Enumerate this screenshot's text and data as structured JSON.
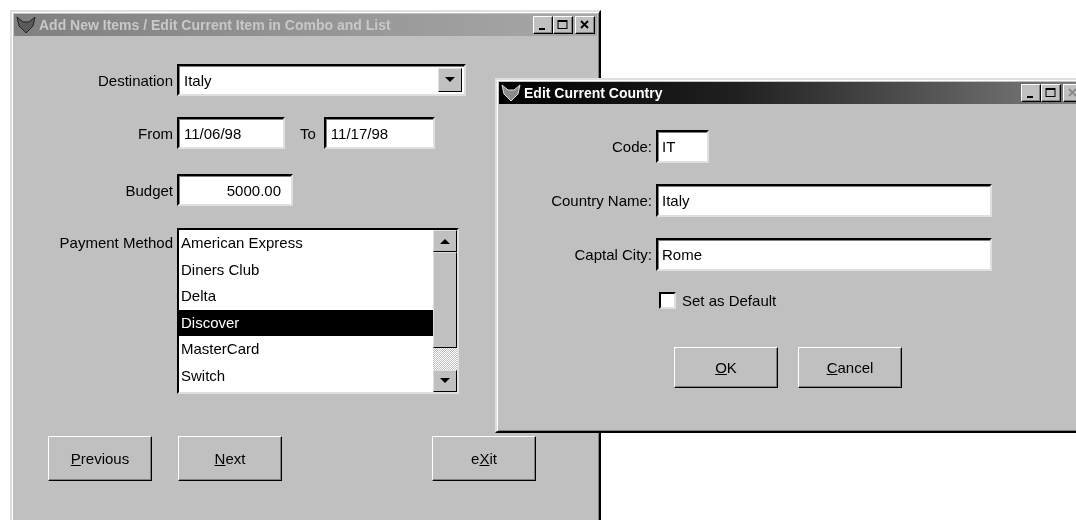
{
  "main_window": {
    "title": "Add New Items / Edit Current Item in Combo and List",
    "active": false,
    "destination": {
      "label": "Destination",
      "value": "Italy"
    },
    "from": {
      "label": "From",
      "value": "11/06/98"
    },
    "to": {
      "label": "To",
      "value": "11/17/98"
    },
    "budget": {
      "label": "Budget",
      "value": "5000.00"
    },
    "payment_method": {
      "label": "Payment Method",
      "items": [
        {
          "text": "American Express",
          "selected": false
        },
        {
          "text": "Diners Club",
          "selected": false
        },
        {
          "text": "Delta",
          "selected": false
        },
        {
          "text": "Discover",
          "selected": true
        },
        {
          "text": "MasterCard",
          "selected": false
        },
        {
          "text": "Switch",
          "selected": false
        }
      ]
    },
    "buttons": [
      {
        "key": "P",
        "after": "revious"
      },
      {
        "key": "N",
        "after": "ext"
      },
      {
        "before": "e",
        "key": "X",
        "after": "it"
      }
    ]
  },
  "dialog": {
    "title": "Edit Current Country",
    "active": true,
    "fields": [
      {
        "label": "Code:",
        "value": "IT",
        "kind": "short"
      },
      {
        "label": "Country Name:",
        "value": "Italy",
        "kind": "wide"
      },
      {
        "label": "Captal City:",
        "value": "Rome",
        "kind": "wide"
      }
    ],
    "default_checkbox": {
      "label": "Set as Default",
      "checked": false
    },
    "buttons": [
      {
        "key": "O",
        "after": "K"
      },
      {
        "key": "C",
        "after": "ancel"
      }
    ]
  }
}
